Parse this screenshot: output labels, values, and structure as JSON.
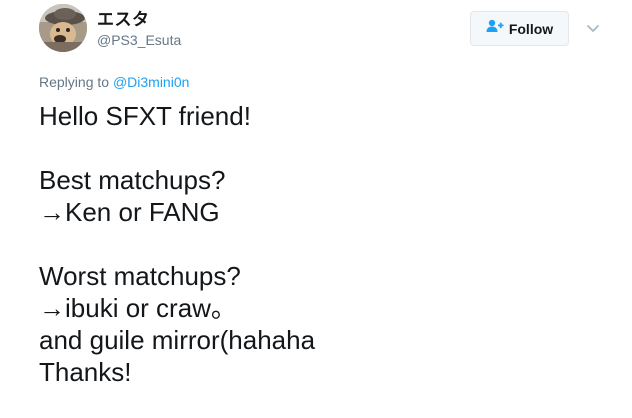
{
  "user": {
    "display_name": "エスタ",
    "screen_name": "@PS3_Esuta"
  },
  "follow_button": {
    "label": "Follow",
    "icon": "follow-user-icon"
  },
  "menu": {
    "icon": "chevron-down-icon"
  },
  "reply": {
    "prefix": "Replying to",
    "mention": "@Di3mini0n"
  },
  "tweet": {
    "lines": [
      "Hello SFXT friend!",
      "",
      "Best matchups?",
      "→Ken or FANG",
      "",
      "Worst matchups?",
      "→ibuki or craw。",
      "and guile mirror(hahaha",
      "Thanks!"
    ]
  },
  "colors": {
    "accent": "#1da1f2",
    "secondary_text": "#657786",
    "primary_text": "#14171a"
  }
}
